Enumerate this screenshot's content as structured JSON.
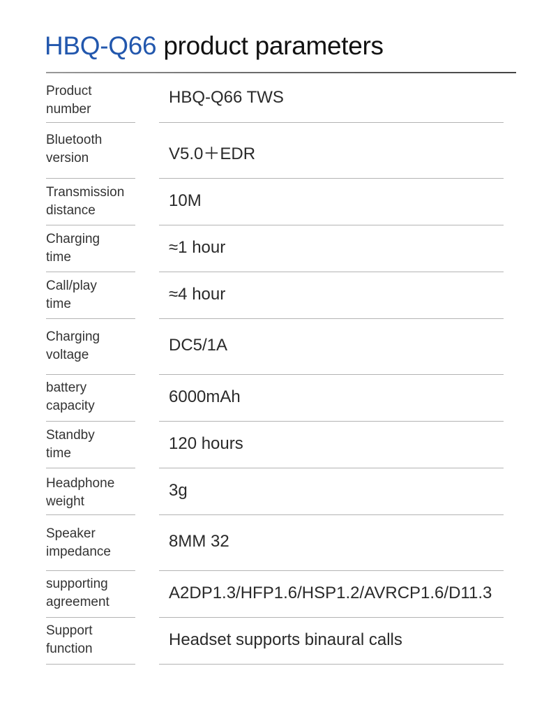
{
  "header": {
    "model": "HBQ-Q66",
    "title_rest": " product parameters",
    "accent_color": "#2257ad"
  },
  "rows": [
    {
      "label": [
        "Product",
        "number"
      ],
      "value": "HBQ-Q66 TWS"
    },
    {
      "label": [
        "Bluetooth",
        "version"
      ],
      "value": "V5.0＋EDR"
    },
    {
      "label": [
        "Transmission",
        "distance"
      ],
      "value": "10M"
    },
    {
      "label": [
        "Charging",
        "time"
      ],
      "value": "≈1 hour"
    },
    {
      "label": [
        "Call/play",
        "time"
      ],
      "value": "≈4 hour"
    },
    {
      "label": [
        "Charging",
        "voltage"
      ],
      "value": "DC5/1A"
    },
    {
      "label": [
        "battery",
        "capacity"
      ],
      "value": "6000mAh"
    },
    {
      "label": [
        "Standby",
        "time"
      ],
      "value": "120 hours"
    },
    {
      "label": [
        "Headphone",
        "weight"
      ],
      "value": "3g"
    },
    {
      "label": [
        "Speaker",
        "impedance"
      ],
      "value": "8MM 32"
    },
    {
      "label": [
        "supporting",
        "agreement"
      ],
      "value": "A2DP1.3/HFP1.6/HSP1.2/AVRCP1.6/D11.3"
    },
    {
      "label": [
        "Support",
        "function"
      ],
      "value": "Headset supports binaural calls"
    }
  ]
}
